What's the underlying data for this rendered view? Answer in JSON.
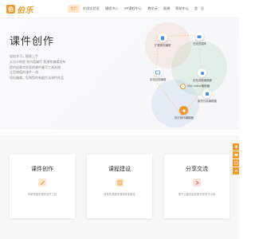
{
  "brand": {
    "logo_text": "伯乐",
    "accent": "#f39a2b"
  },
  "nav": {
    "items": [
      {
        "label": "首页",
        "active": true
      },
      {
        "label": "在线实验室"
      },
      {
        "label": "课程中心"
      },
      {
        "label": "VR课程中心"
      },
      {
        "label": "教学云"
      },
      {
        "label": "直播"
      },
      {
        "label": "帮助中心"
      },
      {
        "label": "登 · 注"
      }
    ]
  },
  "hero": {
    "title": "课件创作",
    "lines": [
      "轻松学习，随意上手",
      "从设计构思 到内容编写 到课件编辑发布",
      "提供创意实验室的课件编写工具系统",
      "让您增值的课件一线",
      "轻松编辑，您和您的有趣方法课件作品"
    ]
  },
  "diagram": {
    "hub_label": "VBC editor编辑器",
    "nodes": [
      {
        "label": "扩展素材编辑"
      },
      {
        "label": "在线资源库"
      },
      {
        "label": "实验可视编辑"
      },
      {
        "label": "实验流程编辑器"
      },
      {
        "label": "素质仿真编辑器"
      },
      {
        "label": "执行操作编辑器"
      }
    ]
  },
  "cards": [
    {
      "title": "课件创作",
      "desc": "简单快速的课件创作工具",
      "icon": "edit-icon",
      "color": "#f39a2b"
    },
    {
      "title": "课程建设",
      "desc": "有效的课程资源和质量建设",
      "icon": "book-icon",
      "color": "#f39a2b"
    },
    {
      "title": "分享交流",
      "desc": "基于云端的高效和开放学习空间",
      "icon": "share-icon",
      "color": "#e85a5a"
    }
  ],
  "side_tools": [
    "phone-icon",
    "chat-icon",
    "qr-icon",
    "top-icon"
  ]
}
